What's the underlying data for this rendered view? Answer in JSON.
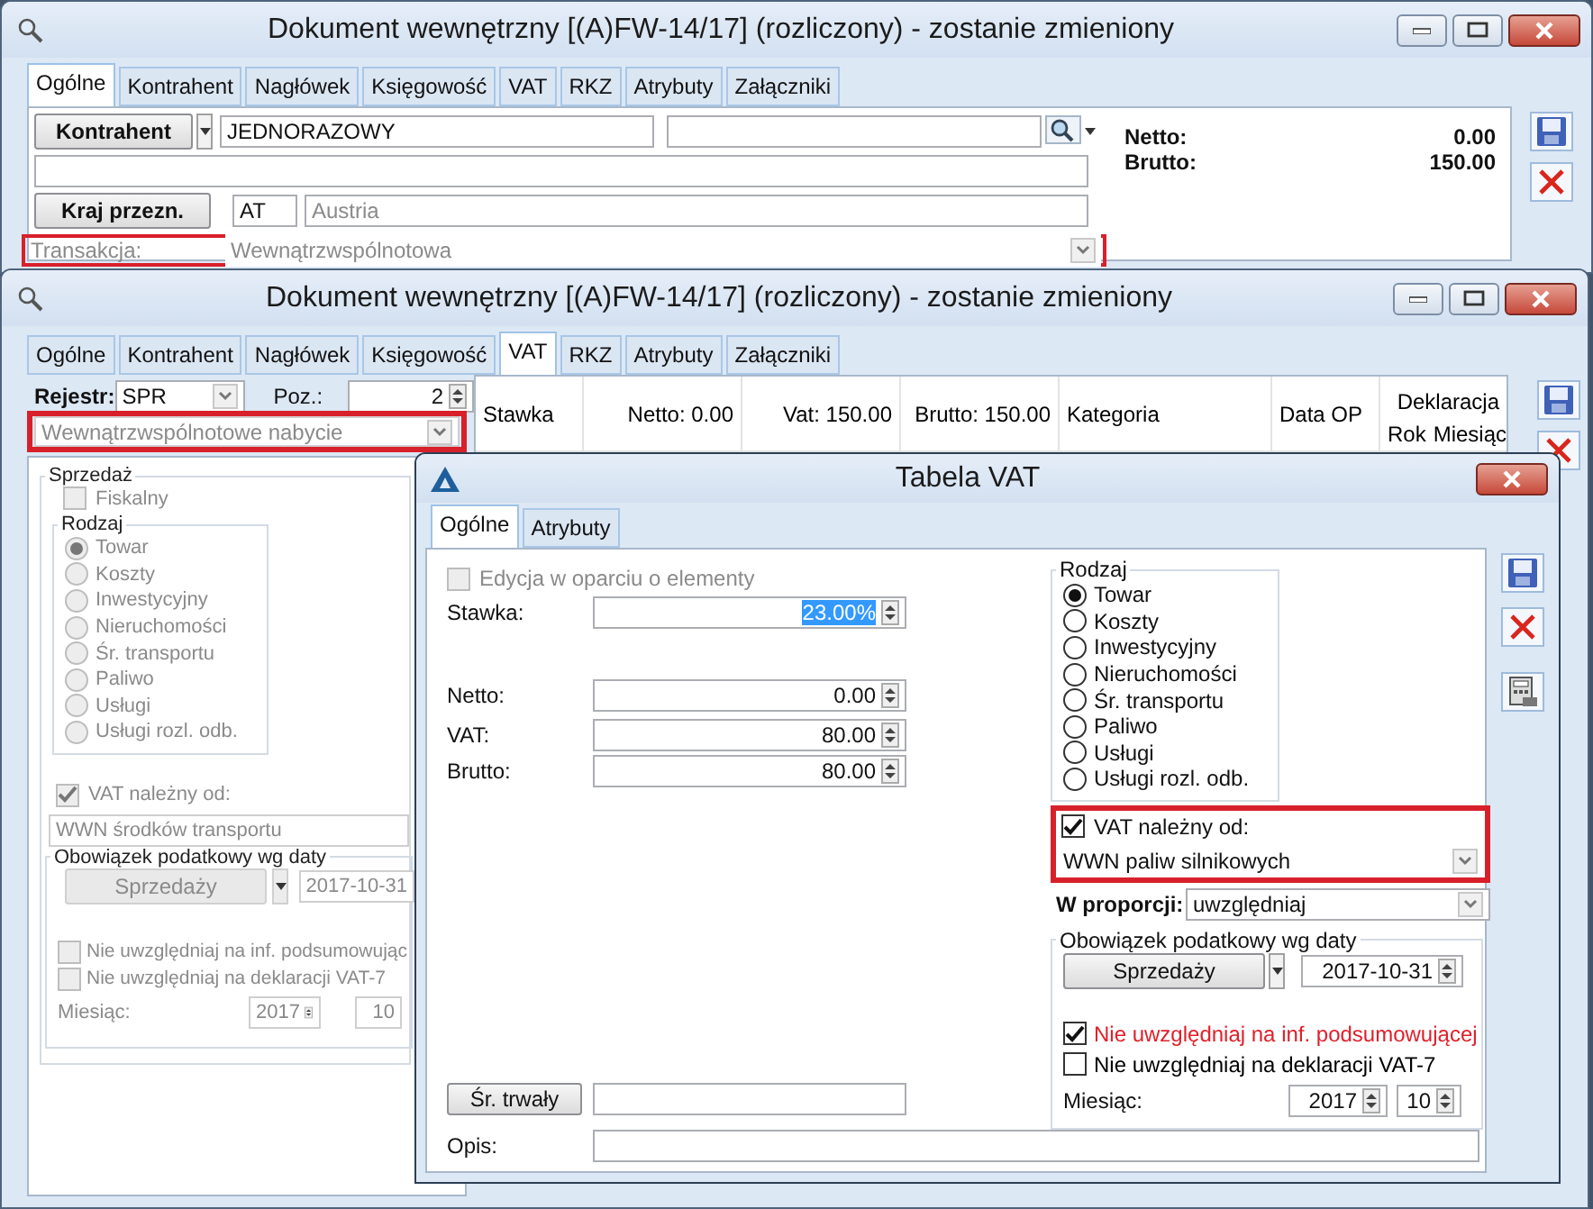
{
  "main_window": {
    "title": "Dokument wewnętrzny [(A)FW-14/17] (rozliczony) - zostanie zmieniony",
    "tabs": [
      {
        "label": "Ogólne",
        "selected": true
      },
      {
        "label": "Kontrahent",
        "selected": false
      },
      {
        "label": "Nagłówek",
        "selected": false
      },
      {
        "label": "Księgowość",
        "selected": false
      },
      {
        "label": "VAT",
        "selected": false
      },
      {
        "label": "RKZ",
        "selected": false
      },
      {
        "label": "Atrybuty",
        "selected": false
      },
      {
        "label": "Załączniki",
        "selected": false
      }
    ],
    "contractor_button": "Kontrahent",
    "contractor_value": "JEDNORAZOWY",
    "summary": [
      {
        "label": "Netto:",
        "value": "0.00"
      },
      {
        "label": "Brutto:",
        "value": "150.00"
      }
    ],
    "country_button": "Kraj przezn.",
    "country_code": "AT",
    "country_name": "Austria",
    "transaction": {
      "label": "Transakcja:",
      "value": "Wewnątrzwspólnotowa",
      "highlighted": true
    }
  },
  "vat_window": {
    "title": "Dokument wewnętrzny [(A)FW-14/17] (rozliczony) - zostanie zmieniony",
    "tabs": [
      {
        "label": "Ogólne",
        "selected": false
      },
      {
        "label": "Kontrahent",
        "selected": false
      },
      {
        "label": "Nagłówek",
        "selected": false
      },
      {
        "label": "Księgowość",
        "selected": false
      },
      {
        "label": "VAT",
        "selected": true
      },
      {
        "label": "RKZ",
        "selected": false
      },
      {
        "label": "Atrybuty",
        "selected": false
      },
      {
        "label": "Załączniki",
        "selected": false
      }
    ],
    "register": {
      "label": "Rejestr:",
      "value": "SPR"
    },
    "position": {
      "label": "Poz.:",
      "value": "2"
    },
    "transaction_type": {
      "value": "Wewnątrzwspólnotowe nabycie",
      "highlighted": true
    },
    "sale_group": {
      "title": "Sprzedaż",
      "disabled": true,
      "fiscal": {
        "label": "Fiskalny",
        "checked": false
      },
      "kind_group": {
        "title": "Rodzaj",
        "options": [
          {
            "label": "Towar",
            "selected": true
          },
          {
            "label": "Koszty",
            "selected": false
          },
          {
            "label": "Inwestycyjny",
            "selected": false
          },
          {
            "label": "Nieruchomości",
            "selected": false
          },
          {
            "label": "Śr. transportu",
            "selected": false
          },
          {
            "label": "Paliwo",
            "selected": false
          },
          {
            "label": "Usługi",
            "selected": false
          },
          {
            "label": "Usługi rozl. odb.",
            "selected": false
          }
        ]
      },
      "vat_due": {
        "label": "VAT należny od:",
        "checked": true,
        "value": "WWN środków transportu"
      },
      "tax_date": {
        "title": "Obowiązek podatkowy wg daty",
        "button": "Sprzedaży",
        "date": "2017-10-31"
      },
      "exclusions": [
        {
          "label": "Nie uwzględniaj na inf. podsumowując",
          "checked": false
        },
        {
          "label": "Nie uwzględniaj na deklaracji VAT-7",
          "checked": false
        }
      ],
      "month": {
        "label": "Miesiąc:",
        "year": "2017",
        "month": "10"
      }
    },
    "table_columns": [
      "Stawka",
      "Netto: 0.00",
      "Vat: 150.00",
      "Brutto: 150.00",
      "Kategoria",
      "Data OP"
    ],
    "declaration": {
      "title": "Deklaracja",
      "columns": [
        "Rok",
        "Miesiąc"
      ]
    }
  },
  "dialog": {
    "title": "Tabela VAT",
    "tabs": [
      {
        "label": "Ogólne",
        "selected": true
      },
      {
        "label": "Atrybuty",
        "selected": false
      }
    ],
    "edit_by_elements": {
      "label": "Edycja w oparciu o elementy",
      "checked": false,
      "disabled": true
    },
    "rate": {
      "label": "Stawka:",
      "value": "23.00%",
      "text_selected": true
    },
    "amounts": [
      {
        "label": "Netto:",
        "value": "0.00"
      },
      {
        "label": "VAT:",
        "value": "80.00"
      },
      {
        "label": "Brutto:",
        "value": "80.00"
      }
    ],
    "fixed_asset_button": "Śr. trwały",
    "description_label": "Opis:",
    "kind_group": {
      "title": "Rodzaj",
      "options": [
        {
          "label": "Towar",
          "selected": true
        },
        {
          "label": "Koszty",
          "selected": false
        },
        {
          "label": "Inwestycyjny",
          "selected": false
        },
        {
          "label": "Nieruchomości",
          "selected": false
        },
        {
          "label": "Śr. transportu",
          "selected": false
        },
        {
          "label": "Paliwo",
          "selected": false
        },
        {
          "label": "Usługi",
          "selected": false
        },
        {
          "label": "Usługi rozl. odb.",
          "selected": false
        }
      ]
    },
    "vat_due": {
      "label": "VAT należny od:",
      "checked": true,
      "value": "WWN paliw silnikowych",
      "highlighted": true
    },
    "proportion": {
      "label": "W proporcji:",
      "value": "uwzględniaj"
    },
    "tax_date": {
      "title": "Obowiązek podatkowy wg daty",
      "button": "Sprzedaży",
      "date": "2017-10-31"
    },
    "exclusions": [
      {
        "label": "Nie uwzględniaj na inf. podsumowującej",
        "checked": true,
        "color": "#e0202a"
      },
      {
        "label": "Nie uwzględniaj na deklaracji VAT-7",
        "checked": false,
        "color": "#000000"
      }
    ],
    "month": {
      "label": "Miesiąc:",
      "year": "2017",
      "month": "10"
    }
  }
}
